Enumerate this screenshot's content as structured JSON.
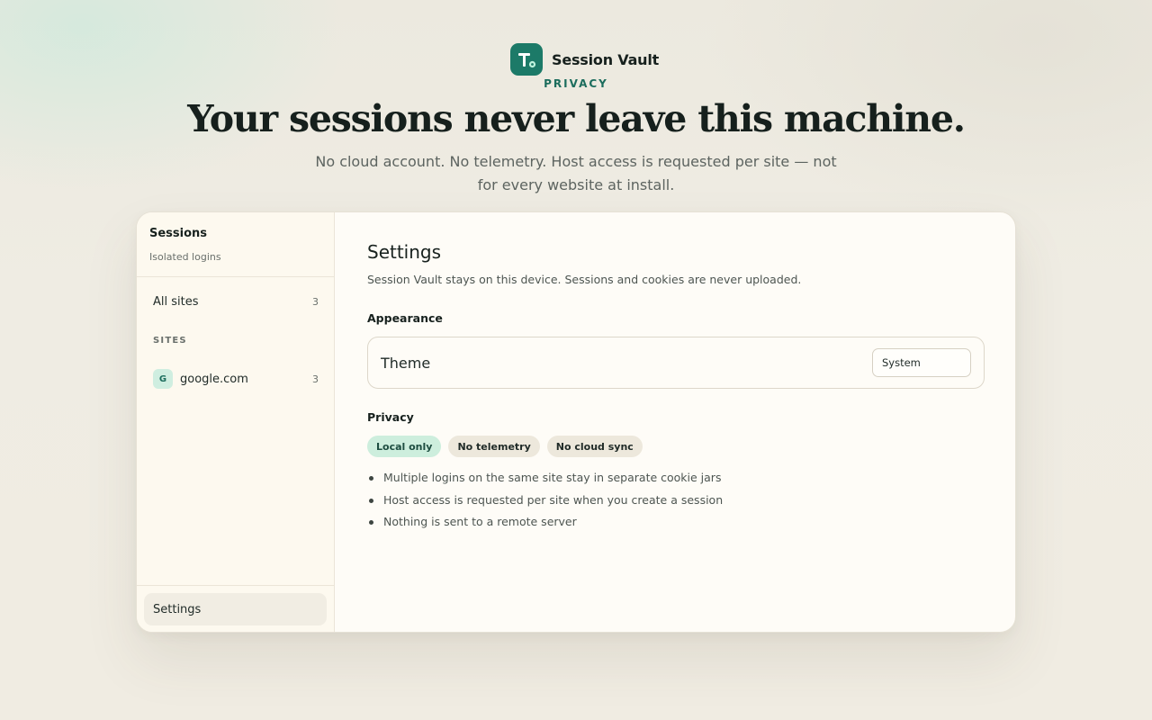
{
  "brand": {
    "name": "Session Vault",
    "eyebrow": "PRIVACY",
    "logo_icon": "vault-logo-icon",
    "accent_color": "#1c7a68"
  },
  "hero": {
    "headline": "Your sessions never leave this machine.",
    "subline": "No cloud account. No telemetry. Host access is requested per site — not for every website at install."
  },
  "sidebar": {
    "title": "Sessions",
    "subtitle": "Isolated logins",
    "all_sites": {
      "label": "All sites",
      "count": "3"
    },
    "section_label": "SITES",
    "sites": [
      {
        "badge": "G",
        "label": "google.com",
        "count": "3"
      }
    ],
    "footer_item": "Settings"
  },
  "settings": {
    "title": "Settings",
    "description": "Session Vault stays on this device. Sessions and cookies are never uploaded.",
    "appearance": {
      "section_label": "Appearance",
      "theme_label": "Theme",
      "theme_value": "System"
    },
    "privacy": {
      "section_label": "Privacy",
      "chips": [
        "Local only",
        "No telemetry",
        "No cloud sync"
      ],
      "bullets": [
        "Multiple logins on the same site stay in separate cookie jars",
        "Host access is requested per site when you create a session",
        "Nothing is sent to a remote server"
      ]
    }
  }
}
